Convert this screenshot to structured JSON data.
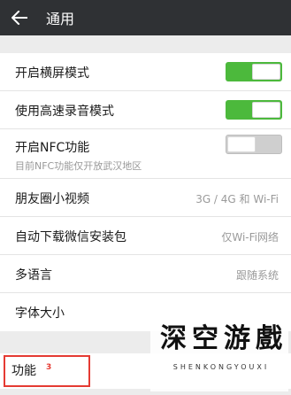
{
  "topbar": {
    "title": "通用",
    "back_icon": "back-arrow-icon"
  },
  "settings": [
    {
      "label": "开启横屏模式",
      "type": "toggle",
      "state": "on"
    },
    {
      "label": "使用高速录音模式",
      "type": "toggle",
      "state": "on"
    },
    {
      "label": "开启NFC功能",
      "sublabel": "目前NFC功能仅开放武汉地区",
      "type": "toggle",
      "state": "off"
    },
    {
      "label": "朋友圈小视频",
      "value": "3G / 4G 和 Wi-Fi"
    },
    {
      "label": "自动下载微信安装包",
      "value": "仅Wi-Fi网络"
    },
    {
      "label": "多语言",
      "value": "跟随系统"
    },
    {
      "label": "字体大小"
    }
  ],
  "function_row": {
    "label": "功能",
    "annotation": "3"
  },
  "watermark": {
    "chars": [
      "深",
      "空",
      "游",
      "戲"
    ],
    "subtitle": "SHENKONGYOUXI"
  },
  "colors": {
    "topbar_bg": "#2f3134",
    "toggle_on": "#4cb93c",
    "toggle_off": "#cfcfcf",
    "highlight": "#e53b33"
  }
}
